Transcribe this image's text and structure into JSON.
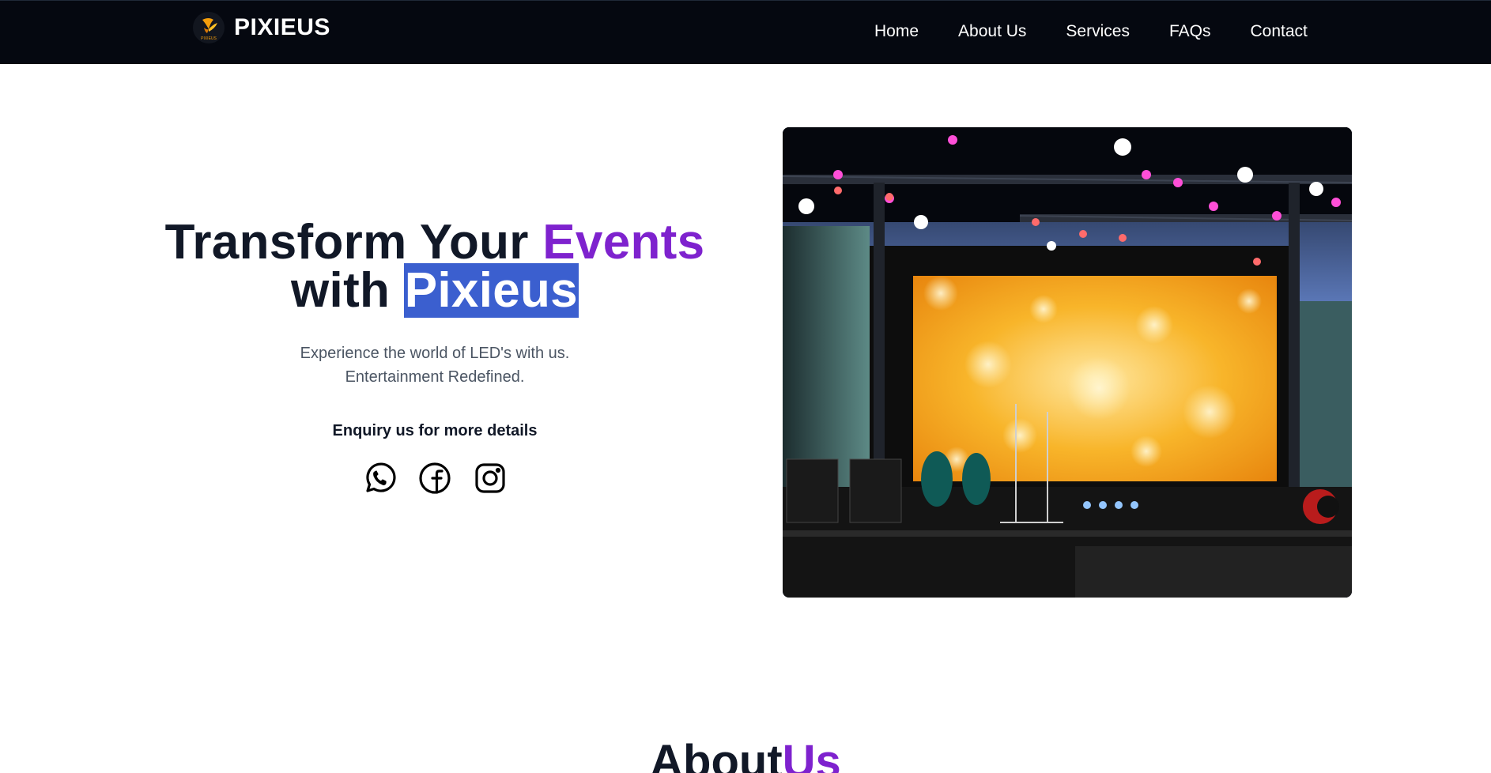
{
  "brand": {
    "name": "PIXIEUS",
    "logo_text": "PIXIEUS"
  },
  "nav": {
    "items": [
      "Home",
      "About Us",
      "Services",
      "FAQs",
      "Contact"
    ]
  },
  "hero": {
    "headline_part1": "Transform Your ",
    "headline_accent": "Events",
    "headline_part2": "with ",
    "headline_highlight": "Pixieus",
    "subtitle_line1": "Experience the world of LED's with us.",
    "subtitle_line2": "Entertainment Redefined.",
    "enquiry": "Enquiry us for more details",
    "socials": [
      "whatsapp-icon",
      "facebook-icon",
      "instagram-icon"
    ],
    "image_alt": "Concert stage with LED screen and lighting rig"
  },
  "about": {
    "title_main": "About",
    "title_accent": "Us"
  },
  "colors": {
    "nav_bg": "#050810",
    "accent": "#7e22ce",
    "selection": "#3b5fcf",
    "text": "#111827"
  }
}
